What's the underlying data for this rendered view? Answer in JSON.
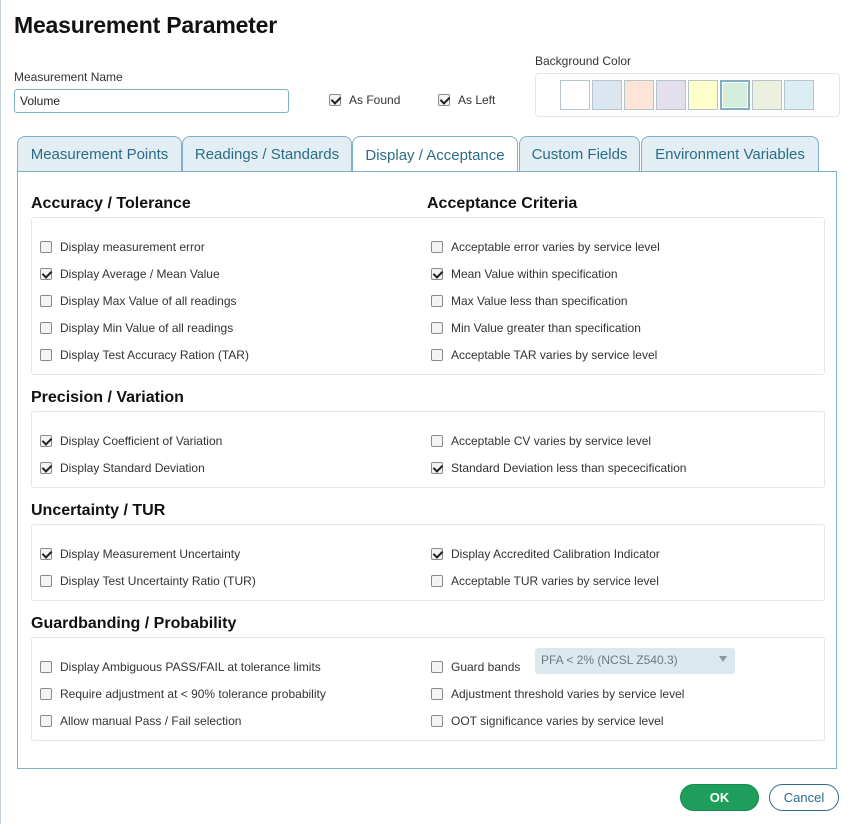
{
  "dialog": {
    "title": "Measurement Parameter"
  },
  "measurement_name": {
    "label": "Measurement Name",
    "value": "Volume"
  },
  "as_found": {
    "label": "As Found",
    "checked": true
  },
  "as_left": {
    "label": "As Left",
    "checked": true
  },
  "background_color": {
    "label": "Background Color",
    "swatches": [
      "#ffffff",
      "#dce6f1",
      "#fce4d6",
      "#e4dfec",
      "#ffffcc",
      "#d4eedb",
      "#ebf1de",
      "#daeef3"
    ],
    "selected_index": 5
  },
  "tabs": [
    {
      "label": "Measurement Points",
      "active": false
    },
    {
      "label": "Readings / Standards",
      "active": false
    },
    {
      "label": "Display / Acceptance",
      "active": true
    },
    {
      "label": "Custom Fields",
      "active": false
    },
    {
      "label": "Environment Variables",
      "active": false
    }
  ],
  "sections": {
    "accuracy": {
      "title": "Accuracy / Tolerance",
      "left": [
        {
          "label": "Display measurement error",
          "checked": false
        },
        {
          "label": "Display Average / Mean Value",
          "checked": true
        },
        {
          "label": "Display Max Value of all readings",
          "checked": false
        },
        {
          "label": "Display Min Value of all readings",
          "checked": false
        },
        {
          "label": "Display Test Accuracy Ration (TAR)",
          "checked": false
        }
      ]
    },
    "acceptance": {
      "title": "Acceptance Criteria",
      "right": [
        {
          "label": "Acceptable error varies by service level",
          "checked": false
        },
        {
          "label": "Mean Value within specification",
          "checked": true
        },
        {
          "label": "Max Value less than specification",
          "checked": false
        },
        {
          "label": "Min Value greater than specification",
          "checked": false
        },
        {
          "label": "Acceptable TAR varies by service level",
          "checked": false
        }
      ]
    },
    "precision": {
      "title": "Precision / Variation",
      "left": [
        {
          "label": "Display Coefficient of Variation",
          "checked": true
        },
        {
          "label": "Display Standard Deviation",
          "checked": true
        }
      ],
      "right": [
        {
          "label": "Acceptable CV varies by service level",
          "checked": false
        },
        {
          "label": "Standard Deviation less than spececification",
          "checked": true
        }
      ]
    },
    "uncertainty": {
      "title": "Uncertainty / TUR",
      "left": [
        {
          "label": "Display Measurement Uncertainty",
          "checked": true
        },
        {
          "label": "Display Test Uncertainty Ratio (TUR)",
          "checked": false
        }
      ],
      "right": [
        {
          "label": "Display Accredited Calibration Indicator",
          "checked": true
        },
        {
          "label": "Acceptable TUR varies by service level",
          "checked": false
        }
      ]
    },
    "guardbanding": {
      "title": "Guardbanding / Probability",
      "left": [
        {
          "label": "Display Ambiguous PASS/FAIL at tolerance limits",
          "checked": false
        },
        {
          "label": "Require adjustment at < 90% tolerance probability",
          "checked": false
        },
        {
          "label": "Allow manual Pass / Fail selection",
          "checked": false
        }
      ],
      "right": [
        {
          "label": "Guard bands",
          "checked": false
        },
        {
          "label": "Adjustment threshold varies by service level",
          "checked": false
        },
        {
          "label": "OOT significance varies by service level",
          "checked": false
        }
      ],
      "guard_band_select": "PFA < 2% (NCSL Z540.3)"
    }
  },
  "buttons": {
    "ok": "OK",
    "cancel": "Cancel"
  }
}
